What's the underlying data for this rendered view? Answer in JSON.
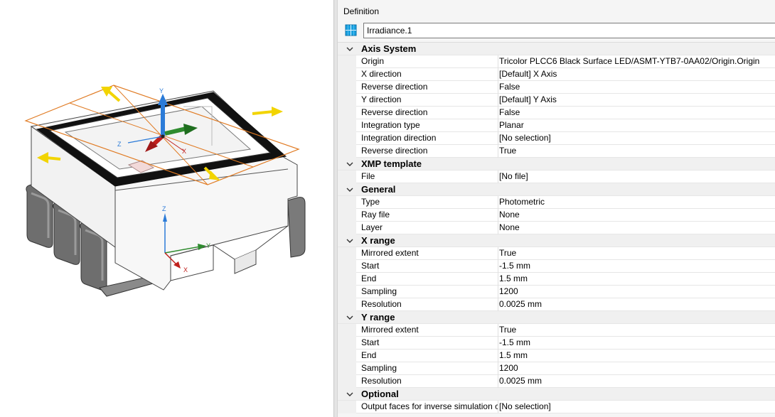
{
  "definition": {
    "title": "Definition",
    "name_value": "Irradiance.1"
  },
  "viewport": {
    "axis_labels": {
      "top_y": "Y",
      "top_z": "Z",
      "top_x": "X",
      "bottom_z": "Z",
      "bottom_y": "Y",
      "bottom_x": "X"
    }
  },
  "colors": {
    "manipulator_orange": "#e07a22",
    "arrow_yellow": "#f2d400",
    "axis_blue": "#2b7bd8",
    "axis_green": "#2e8b2e",
    "axis_red": "#c0201c"
  },
  "sections": [
    {
      "title": "Axis System",
      "rows": [
        {
          "label": "Origin",
          "value": "Tricolor PLCC6 Black Surface LED/ASMT-YTB7-0AA02/Origin.Origin"
        },
        {
          "label": "X direction",
          "value": "[Default] X Axis"
        },
        {
          "label": "Reverse direction",
          "value": "False"
        },
        {
          "label": "Y direction",
          "value": "[Default] Y Axis"
        },
        {
          "label": "Reverse direction",
          "value": "False"
        },
        {
          "label": "Integration type",
          "value": "Planar"
        },
        {
          "label": "Integration direction",
          "value": "[No selection]"
        },
        {
          "label": "Reverse direction",
          "value": "True"
        }
      ]
    },
    {
      "title": "XMP template",
      "rows": [
        {
          "label": "File",
          "value": "[No file]"
        }
      ]
    },
    {
      "title": "General",
      "rows": [
        {
          "label": "Type",
          "value": "Photometric"
        },
        {
          "label": "Ray file",
          "value": "None"
        },
        {
          "label": "Layer",
          "value": "None"
        }
      ]
    },
    {
      "title": "X range",
      "rows": [
        {
          "label": "Mirrored extent",
          "value": "True"
        },
        {
          "label": "Start",
          "value": "-1.5 mm"
        },
        {
          "label": "End",
          "value": "1.5 mm"
        },
        {
          "label": "Sampling",
          "value": "1200"
        },
        {
          "label": "Resolution",
          "value": "0.0025 mm"
        }
      ]
    },
    {
      "title": "Y range",
      "rows": [
        {
          "label": "Mirrored extent",
          "value": "True"
        },
        {
          "label": "Start",
          "value": "-1.5 mm"
        },
        {
          "label": "End",
          "value": "1.5 mm"
        },
        {
          "label": "Sampling",
          "value": "1200"
        },
        {
          "label": "Resolution",
          "value": "0.0025 mm"
        }
      ]
    },
    {
      "title": "Optional",
      "rows": [
        {
          "label": "Output faces for inverse simulation c",
          "value": "[No selection]"
        }
      ]
    }
  ]
}
